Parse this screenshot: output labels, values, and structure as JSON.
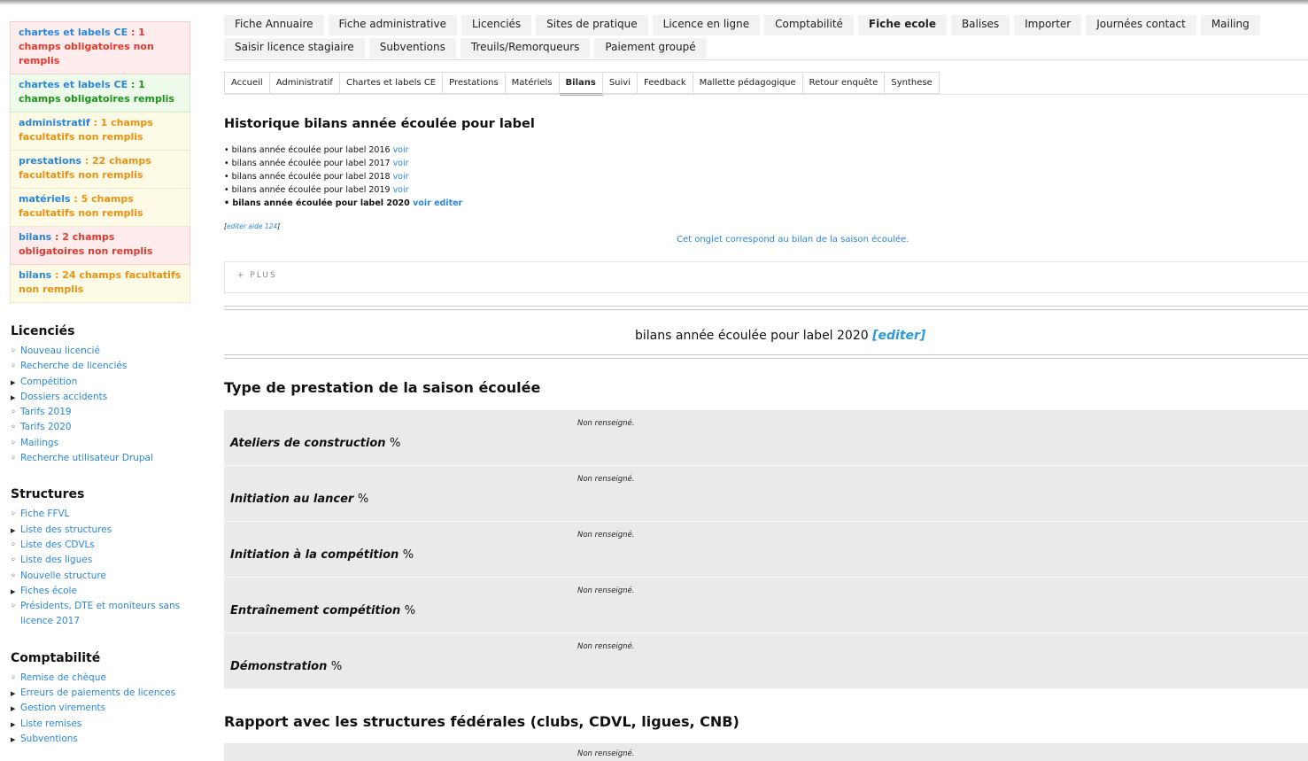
{
  "sidebar": {
    "notices": [
      {
        "key": "chartes et labels CE",
        "text": " : 1 champs obligatoires non remplis",
        "variant": "red"
      },
      {
        "key": "chartes et labels CE",
        "text": " : 1 champs obligatoires remplis",
        "variant": "green"
      },
      {
        "key": "administratif",
        "text": " : 1 champs facultatifs non remplis",
        "variant": "yellow"
      },
      {
        "key": "prestations",
        "text": " : 22 champs facultatifs non remplis",
        "variant": "yellow"
      },
      {
        "key": "matériels",
        "text": " : 5 champs facultatifs non remplis",
        "variant": "yellow"
      },
      {
        "key": "bilans",
        "text": " : 2 champs obligatoires non remplis",
        "variant": "red"
      },
      {
        "key": "bilans",
        "text": " : 24 champs facultatifs non remplis",
        "variant": "yellow"
      }
    ],
    "blocks": [
      {
        "title": "Licenciés",
        "items": [
          {
            "label": "Nouveau licencié",
            "bullet": "o"
          },
          {
            "label": "Recherche de licenciés",
            "bullet": "o"
          },
          {
            "label": "Compétition",
            "bullet": "tri"
          },
          {
            "label": "Dossiers accidents",
            "bullet": "tri"
          },
          {
            "label": "Tarifs 2019",
            "bullet": "o"
          },
          {
            "label": "Tarifs 2020",
            "bullet": "o"
          },
          {
            "label": "Mailings",
            "bullet": "o"
          },
          {
            "label": "Recherche utilisateur Drupal",
            "bullet": "o"
          }
        ]
      },
      {
        "title": "Structures",
        "items": [
          {
            "label": "Fiche FFVL",
            "bullet": "o"
          },
          {
            "label": "Liste des structures",
            "bullet": "tri"
          },
          {
            "label": "Liste des CDVLs",
            "bullet": "o"
          },
          {
            "label": "Liste des ligues",
            "bullet": "o"
          },
          {
            "label": "Nouvelle structure",
            "bullet": "o"
          },
          {
            "label": "Fiches école",
            "bullet": "tri"
          },
          {
            "label": "Présidents, DTE et moniteurs sans licence 2017",
            "bullet": "o"
          }
        ]
      },
      {
        "title": "Comptabilité",
        "items": [
          {
            "label": "Remise de chèque",
            "bullet": "o"
          },
          {
            "label": "Erreurs de paiements de licences",
            "bullet": "tri"
          },
          {
            "label": "Gestion virements",
            "bullet": "tri"
          },
          {
            "label": "Liste remises",
            "bullet": "tri"
          },
          {
            "label": "Subventions",
            "bullet": "tri"
          }
        ]
      }
    ]
  },
  "main_tabs": {
    "row1": [
      "Fiche Annuaire",
      "Fiche administrative",
      "Licenciés",
      "Sites de pratique",
      "Licence en ligne",
      "Comptabilité",
      "Fiche ecole",
      "Balises",
      "Importer",
      "Journées contact",
      "Mailing"
    ],
    "row2": [
      "Saisir licence stagiaire",
      "Subventions",
      "Treuils/Remorqueurs",
      "Paiement groupé"
    ],
    "active": "Fiche ecole"
  },
  "sub_tabs": {
    "items": [
      "Accueil",
      "Administratif",
      "Chartes et labels CE",
      "Prestations",
      "Matériels",
      "Bilans",
      "Suivi",
      "Feedback",
      "Mallette pédagogique",
      "Retour enquête",
      "Synthese"
    ],
    "active": "Bilans"
  },
  "history": {
    "title": "Historique bilans année écoulée pour label",
    "items": [
      {
        "text": "bilans année écoulée pour label 2016",
        "links": [
          "voir"
        ],
        "current": false
      },
      {
        "text": "bilans année écoulée pour label 2017",
        "links": [
          "voir"
        ],
        "current": false
      },
      {
        "text": "bilans année écoulée pour label 2018",
        "links": [
          "voir"
        ],
        "current": false
      },
      {
        "text": "bilans année écoulée pour label 2019",
        "links": [
          "voir"
        ],
        "current": false
      },
      {
        "text": "bilans année écoulée pour label 2020",
        "links": [
          "voir",
          "editer"
        ],
        "current": true
      }
    ],
    "edit_help": "editer aide 124",
    "season_note": "Cet onglet correspond au bilan de la saison écoulée."
  },
  "plus_label": "PLUS",
  "bilan": {
    "title": "bilans année écoulée pour label 2020",
    "edit_link": "[editer]"
  },
  "sections": [
    {
      "title": "Type de prestation de la saison écoulée",
      "fields": [
        {
          "label": "Ateliers de construction",
          "unit": "%",
          "value": "Non renseigné."
        },
        {
          "label": "Initiation au lancer",
          "unit": "%",
          "value": "Non renseigné."
        },
        {
          "label": "Initiation à la compétition",
          "unit": "%",
          "value": "Non renseigné."
        },
        {
          "label": "Entraînement compétition",
          "unit": "%",
          "value": "Non renseigné."
        },
        {
          "label": "Démonstration",
          "unit": "%",
          "value": "Non renseigné."
        }
      ]
    },
    {
      "title": "Rapport avec les structures fédérales (clubs, CDVL, ligues, CNB)",
      "fields": [
        {
          "label": "",
          "unit": "",
          "value": "Non renseigné."
        }
      ]
    }
  ]
}
